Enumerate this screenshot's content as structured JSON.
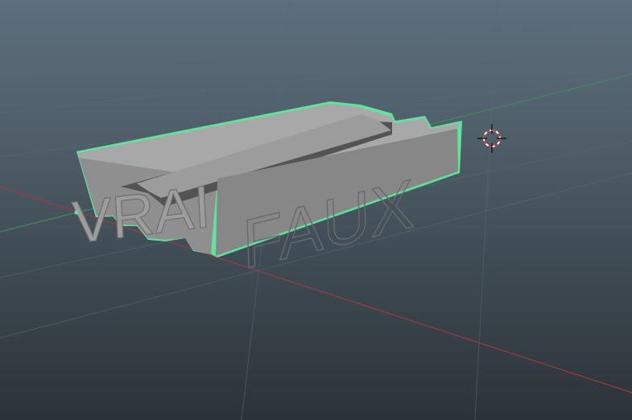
{
  "viewport": {
    "background_top": "#5d6f7c",
    "background_bottom": "#2c3338",
    "grid_color": "#55646f",
    "x_axis_color": "#a33a3f",
    "z_axis_color": "#3f8f5a",
    "selection_outline_color": "#5be39a"
  },
  "model": {
    "front_text": "VRAI",
    "back_text": "FAUX",
    "face_color": "#8a8a8a",
    "side_color": "#6c6c6c",
    "top_color": "#9a9a9a"
  },
  "pivot": {
    "icon": "3d-cursor-icon",
    "ring_color": "#d23030"
  }
}
